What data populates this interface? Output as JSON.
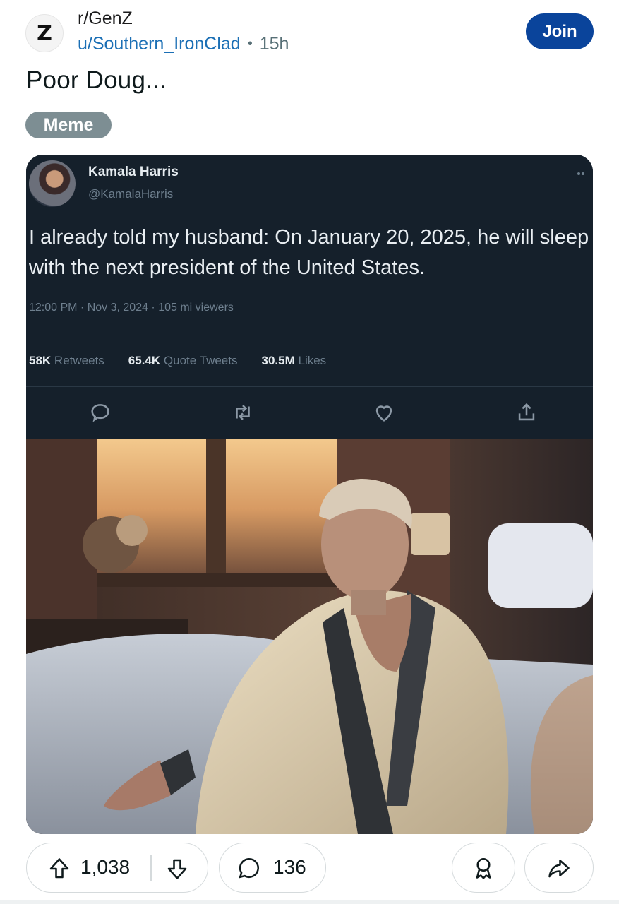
{
  "post": {
    "subreddit": "r/GenZ",
    "subreddit_icon_letter": "Z",
    "author": "u/Southern_IronClad",
    "separator": "•",
    "age": "15h",
    "join_label": "Join",
    "title": "Poor Doug...",
    "flair": "Meme"
  },
  "tweet": {
    "name": "Kamala Harris",
    "handle": "@KamalaHarris",
    "text": "I already told my husband: On January 20, 2025, he will sleep with the next president of the United States.",
    "meta": "12:00 PM · Nov 3, 2024 · 105 mi viewers",
    "stats": [
      {
        "value": "58K",
        "label": "Retweets"
      },
      {
        "value": "65.4K",
        "label": "Quote Tweets"
      },
      {
        "value": "30.5M",
        "label": "Likes"
      }
    ],
    "icons": [
      "reply-icon",
      "retweet-icon",
      "like-icon",
      "share-icon"
    ]
  },
  "footer": {
    "upvotes": "1,038",
    "comments": "136"
  },
  "colors": {
    "join_bg": "#0a449b",
    "author_link": "#1b6fb5",
    "flair_bg": "#7d8e93",
    "tweet_bg": "#15202b"
  }
}
